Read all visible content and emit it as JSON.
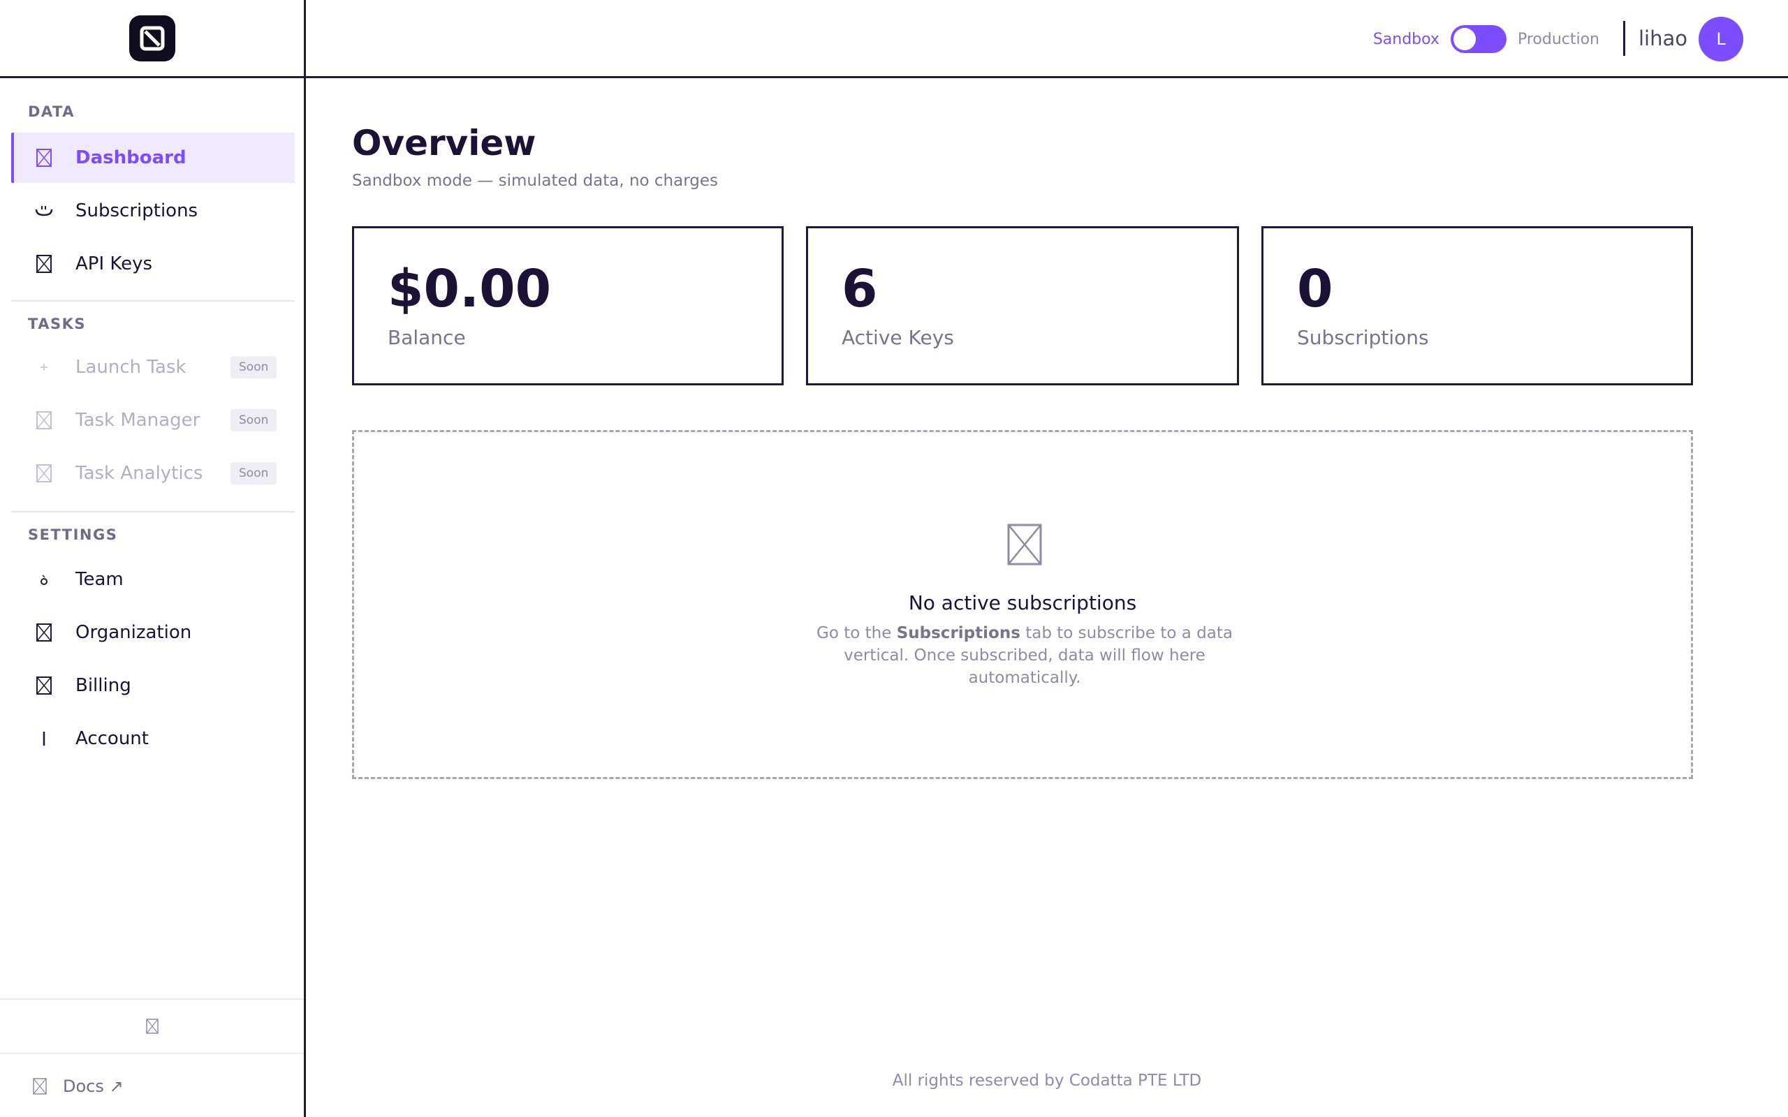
{
  "header": {
    "env_sandbox": "Sandbox",
    "env_production": "Production",
    "username": "lihao",
    "avatar_initial": "L"
  },
  "sidebar": {
    "sections": [
      {
        "title": "DATA"
      },
      {
        "title": "TASKS"
      },
      {
        "title": "SETTINGS"
      }
    ],
    "items": [
      {
        "label": "Dashboard",
        "icon": "broken-image-icon",
        "active": true
      },
      {
        "label": "Subscriptions",
        "icon": "subscriptions-icon"
      },
      {
        "label": "API Keys",
        "icon": "broken-image-icon"
      },
      {
        "label": "Launch Task",
        "icon": "sparkle-icon",
        "badge": "Soon",
        "disabled": true
      },
      {
        "label": "Task Manager",
        "icon": "broken-image-icon",
        "badge": "Soon",
        "disabled": true
      },
      {
        "label": "Task Analytics",
        "icon": "broken-image-icon",
        "badge": "Soon",
        "disabled": true
      },
      {
        "label": "Team",
        "icon": "team-icon"
      },
      {
        "label": "Organization",
        "icon": "broken-image-icon"
      },
      {
        "label": "Billing",
        "icon": "broken-image-icon"
      },
      {
        "label": "Account",
        "icon": "account-icon"
      }
    ],
    "docs_label": "Docs ↗"
  },
  "main": {
    "title": "Overview",
    "subtitle": "Sandbox mode — simulated data, no charges",
    "stats": [
      {
        "value": "$0.00",
        "label": "Balance"
      },
      {
        "value": "6",
        "label": "Active Keys"
      },
      {
        "value": "0",
        "label": "Subscriptions"
      }
    ],
    "empty_state": {
      "title": "No active subscriptions",
      "desc_before": "Go to the ",
      "desc_bold": "Subscriptions",
      "desc_after": " tab to subscribe to a data vertical. Once subscribed, data will flow here automatically."
    }
  },
  "footer": {
    "text": "All rights reserved by Codatta PTE LTD"
  },
  "colors": {
    "accent": "#7c4dff",
    "active_bg": "#efeafd",
    "border": "#1f1a3a"
  }
}
